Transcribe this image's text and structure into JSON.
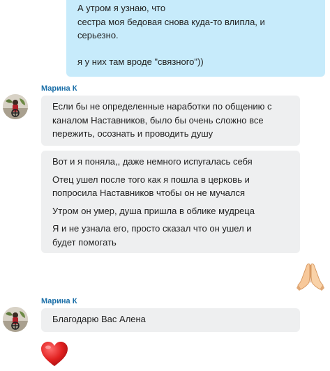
{
  "chat": {
    "outgoing": {
      "lines": [
        "А утром я узнаю, что",
        "сестра моя бедовая снова куда-то влипла, и",
        "серьезно.",
        "я у них там вроде \"связного\"))"
      ]
    },
    "group1": {
      "sender": "Марина К",
      "msg1": {
        "lines": [
          "Если бы не определенные наработки по общению с",
          "каналом Наставников, было бы очень сложно все",
          "пережить, осознать и проводить душу"
        ]
      },
      "msg2": {
        "p1": "Вот и я поняла,, даже немного испугалась себя",
        "p2": [
          "Отец ушел после того как я пошла в церковь и",
          "попросила Наставников чтобы он не мучался"
        ],
        "p3": "Утром он умер, душа пришла в облике мудреца",
        "p4": [
          "Я и не узнала его, просто сказал что он ушел и",
          "будет помогать"
        ]
      }
    },
    "reaction_outgoing": {
      "icon": "praying-hands-icon"
    },
    "group2": {
      "sender": "Марина К",
      "msg": "Благодарю Вас Алена"
    },
    "reaction_incoming": {
      "icon": "red-heart-icon"
    }
  },
  "colors": {
    "outgoing_bubble": "#c7ebfb",
    "incoming_bubble": "#eeeff0",
    "sender_name": "#1b6fa8"
  }
}
